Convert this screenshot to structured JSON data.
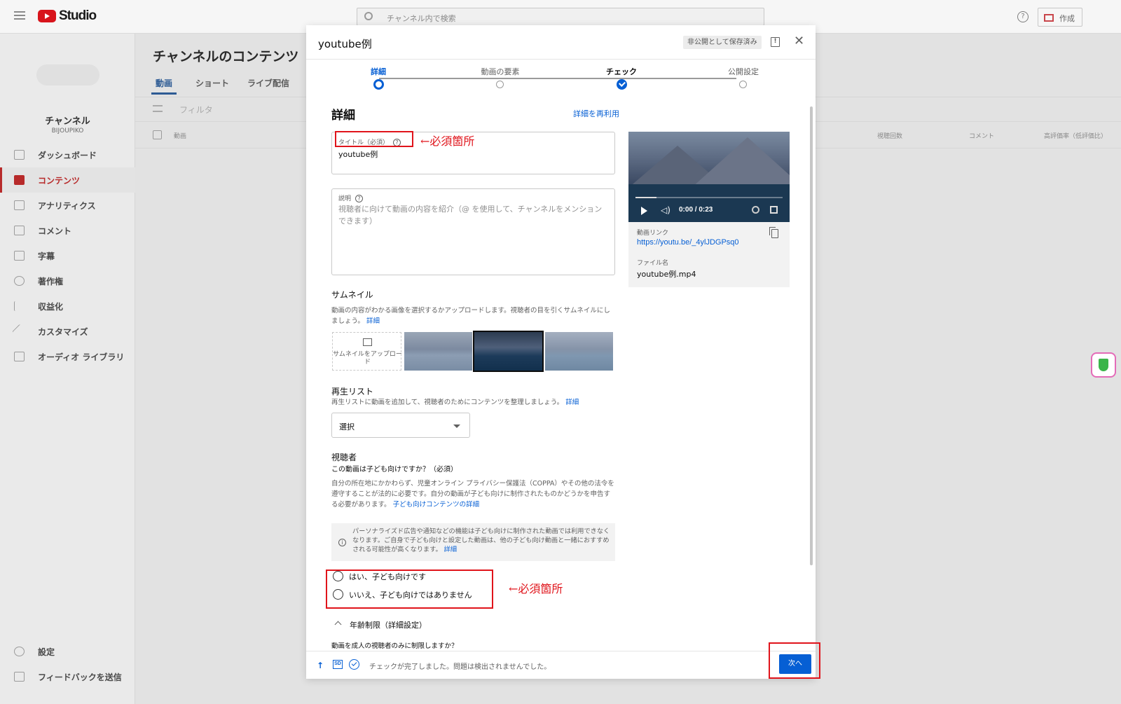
{
  "background": {
    "logo_text": "Studio",
    "search_placeholder": "チャンネル内で検索",
    "create_label": "作成",
    "channel_name": "チャンネル",
    "channel_handle": "BIJOUPIKO",
    "page_title": "チャンネルのコンテンツ",
    "tabs": [
      "動画",
      "ショート",
      "ライブ配信"
    ],
    "filter_placeholder": "フィルタ",
    "table_columns": [
      "動画",
      "視聴回数",
      "コメント",
      "高評価率（低評価比）"
    ],
    "nav": [
      {
        "label": "ダッシュボード",
        "icon": "dashboard-icon"
      },
      {
        "label": "コンテンツ",
        "icon": "content-icon",
        "active": true
      },
      {
        "label": "アナリティクス",
        "icon": "analytics-icon"
      },
      {
        "label": "コメント",
        "icon": "comments-icon"
      },
      {
        "label": "字幕",
        "icon": "subtitles-icon"
      },
      {
        "label": "著作権",
        "icon": "copyright-icon"
      },
      {
        "label": "収益化",
        "icon": "monetization-icon"
      },
      {
        "label": "カスタマイズ",
        "icon": "customize-icon"
      },
      {
        "label": "オーディオ ライブラリ",
        "icon": "audio-library-icon"
      }
    ],
    "nav_bottom": [
      {
        "label": "設定",
        "icon": "settings-icon"
      },
      {
        "label": "フィードバックを送信",
        "icon": "feedback-icon"
      }
    ]
  },
  "modal": {
    "title": "youtube例",
    "saved_status": "非公開として保存済み",
    "steps": [
      {
        "label": "詳細",
        "state": "current"
      },
      {
        "label": "動画の要素",
        "state": "pending"
      },
      {
        "label": "チェック",
        "state": "done"
      },
      {
        "label": "公開設定",
        "state": "pending"
      }
    ],
    "section_title": "詳細",
    "reuse_link": "詳細を再利用",
    "title_field": {
      "label": "タイトル（必須）",
      "value": "youtube例"
    },
    "description_field": {
      "label": "説明",
      "placeholder": "視聴者に向けて動画の内容を紹介（@ を使用して、チャンネルをメンションできます）"
    },
    "annotation": "←必須箇所",
    "preview": {
      "time": "0:00 / 0:23",
      "link_label": "動画リンク",
      "link": "https://youtu.be/_4ylJDGPsq0",
      "filename_label": "ファイル名",
      "filename": "youtube例.mp4"
    },
    "thumbnail": {
      "title": "サムネイル",
      "desc": "動画の内容がわかる画像を選択するかアップロードします。視聴者の目を引くサムネイルにしましょう。",
      "link": "詳細",
      "upload_label": "サムネイルをアップロード"
    },
    "playlist": {
      "title": "再生リスト",
      "desc": "再生リストに動画を追加して、視聴者のためにコンテンツを整理しましょう。",
      "link": "詳細",
      "select_value": "選択"
    },
    "audience": {
      "title": "視聴者",
      "question": "この動画は子ども向けですか？（必須）",
      "desc": "自分の所在地にかかわらず、児童オンライン プライバシー保護法（COPPA）やその他の法令を遵守することが法的に必要です。自分の動画が子ども向けに制作されたものかどうかを申告する必要があります。",
      "desc_link": "子ども向けコンテンツの詳細",
      "notice": "パーソナライズド広告や通知などの機能は子ども向けに制作された動画では利用できなくなります。ご自身で子ども向けと設定した動画は、他の子ども向け動画と一緒におすすめされる可能性が高くなります。",
      "notice_link": "詳細",
      "options": [
        "はい、子ども向けです",
        "いいえ、子ども向けではありません"
      ]
    },
    "age_restriction": {
      "label": "年齢制限（詳細設定）",
      "question": "動画を成人の視聴者のみに制限しますか？"
    },
    "footer": {
      "sd_label": "SD",
      "status": "チェックが完了しました。問題は検出されませんでした。",
      "next_label": "次へ"
    }
  }
}
